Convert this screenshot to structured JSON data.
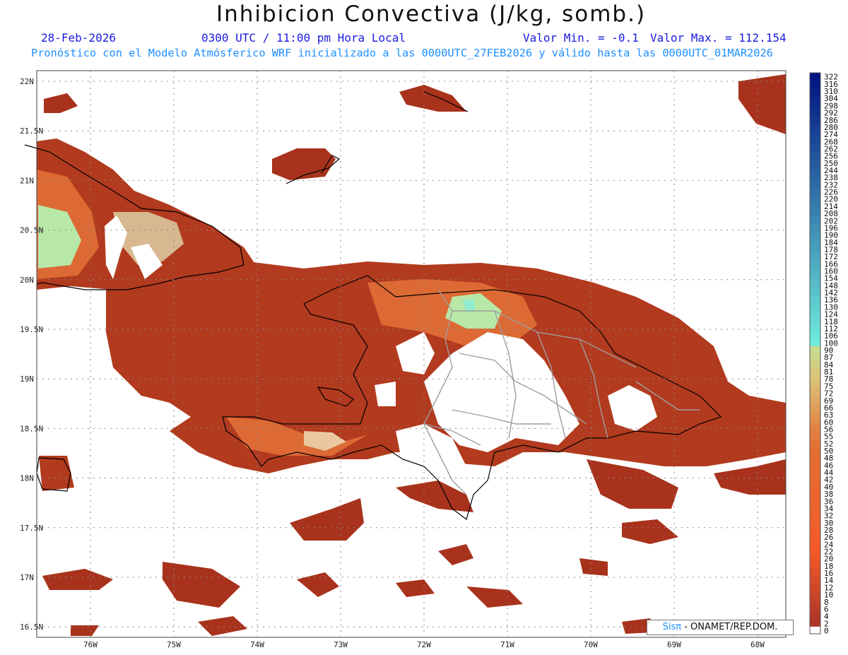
{
  "header": {
    "title": "Inhibicion Convectiva (J/kg, somb.)",
    "date": "28-Feb-2026",
    "time": "0300 UTC / 11:00 pm Hora Local",
    "valor_min": "Valor Min. = -0.1",
    "valor_max": "Valor Max. = 112.154",
    "subtitle": "Pronóstico con el Modelo Atmósferico WRF inicializado a las 0000UTC_27FEB2026 y válido hasta las  0000UTC_01MAR2026"
  },
  "map": {
    "lat_labels": [
      "22N",
      "21.5N",
      "21N",
      "20.5N",
      "20N",
      "19.5N",
      "19N",
      "18.5N",
      "18N",
      "17.5N",
      "17N",
      "16.5N"
    ],
    "lon_labels": [
      "76W",
      "75W",
      "74W",
      "73W",
      "72W",
      "71W",
      "70W",
      "69W",
      "68W"
    ],
    "fill_colors": {
      "dark": "#a8321c",
      "mid": "#c24820",
      "bright": "#e0642c",
      "light": "#e9c8a0",
      "green": "#b8e8a8",
      "cyan": "#90ecd0"
    }
  },
  "colorbar": {
    "labels": [
      "322",
      "316",
      "310",
      "304",
      "298",
      "292",
      "286",
      "280",
      "274",
      "268",
      "262",
      "256",
      "250",
      "244",
      "238",
      "232",
      "226",
      "220",
      "214",
      "208",
      "202",
      "196",
      "190",
      "184",
      "178",
      "172",
      "166",
      "160",
      "154",
      "148",
      "142",
      "136",
      "130",
      "124",
      "118",
      "112",
      "106",
      "100",
      "90",
      "87",
      "84",
      "81",
      "78",
      "75",
      "72",
      "69",
      "66",
      "63",
      "60",
      "56",
      "55",
      "52",
      "50",
      "48",
      "46",
      "44",
      "42",
      "40",
      "38",
      "36",
      "34",
      "32",
      "30",
      "28",
      "26",
      "24",
      "22",
      "20",
      "18",
      "16",
      "14",
      "12",
      "10",
      "8",
      "6",
      "4",
      "2",
      "0"
    ]
  },
  "credit": {
    "sis": "Sisπ",
    "text": "- ONAMET/REP.DOM."
  }
}
